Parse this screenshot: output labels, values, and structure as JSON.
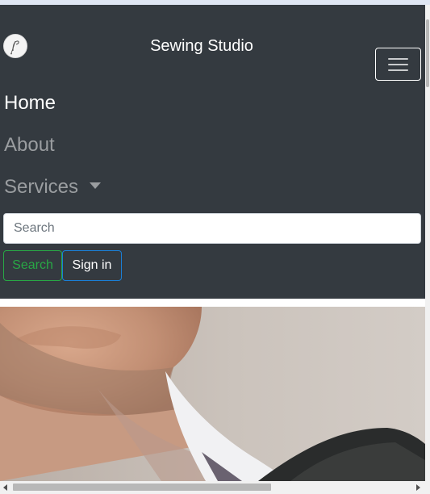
{
  "navbar": {
    "brand": "Sewing Studio",
    "toggler_icon": "hamburger-menu-icon",
    "links": [
      {
        "label": "Home"
      },
      {
        "label": "About"
      },
      {
        "label": "Services"
      }
    ],
    "services_caret_icon": "caret-down-icon",
    "search": {
      "placeholder": "Search",
      "value": ""
    },
    "buttons": {
      "search_label": "Search",
      "signin_label": "Sign in"
    }
  },
  "colors": {
    "navbar_bg": "#343a40",
    "active_link": "#ffffff",
    "inactive_link": "#9a9da0",
    "search_button": "#28a745",
    "signin_button_border": "#1a7fd6"
  },
  "hero": {
    "image": "man-in-suit-photo"
  }
}
